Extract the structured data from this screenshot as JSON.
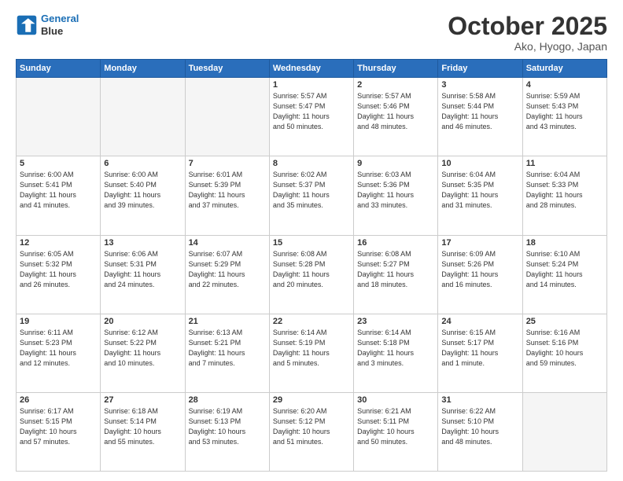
{
  "header": {
    "logo_line1": "General",
    "logo_line2": "Blue",
    "month": "October 2025",
    "location": "Ako, Hyogo, Japan"
  },
  "weekdays": [
    "Sunday",
    "Monday",
    "Tuesday",
    "Wednesday",
    "Thursday",
    "Friday",
    "Saturday"
  ],
  "weeks": [
    [
      {
        "day": "",
        "info": ""
      },
      {
        "day": "",
        "info": ""
      },
      {
        "day": "",
        "info": ""
      },
      {
        "day": "1",
        "info": "Sunrise: 5:57 AM\nSunset: 5:47 PM\nDaylight: 11 hours\nand 50 minutes."
      },
      {
        "day": "2",
        "info": "Sunrise: 5:57 AM\nSunset: 5:46 PM\nDaylight: 11 hours\nand 48 minutes."
      },
      {
        "day": "3",
        "info": "Sunrise: 5:58 AM\nSunset: 5:44 PM\nDaylight: 11 hours\nand 46 minutes."
      },
      {
        "day": "4",
        "info": "Sunrise: 5:59 AM\nSunset: 5:43 PM\nDaylight: 11 hours\nand 43 minutes."
      }
    ],
    [
      {
        "day": "5",
        "info": "Sunrise: 6:00 AM\nSunset: 5:41 PM\nDaylight: 11 hours\nand 41 minutes."
      },
      {
        "day": "6",
        "info": "Sunrise: 6:00 AM\nSunset: 5:40 PM\nDaylight: 11 hours\nand 39 minutes."
      },
      {
        "day": "7",
        "info": "Sunrise: 6:01 AM\nSunset: 5:39 PM\nDaylight: 11 hours\nand 37 minutes."
      },
      {
        "day": "8",
        "info": "Sunrise: 6:02 AM\nSunset: 5:37 PM\nDaylight: 11 hours\nand 35 minutes."
      },
      {
        "day": "9",
        "info": "Sunrise: 6:03 AM\nSunset: 5:36 PM\nDaylight: 11 hours\nand 33 minutes."
      },
      {
        "day": "10",
        "info": "Sunrise: 6:04 AM\nSunset: 5:35 PM\nDaylight: 11 hours\nand 31 minutes."
      },
      {
        "day": "11",
        "info": "Sunrise: 6:04 AM\nSunset: 5:33 PM\nDaylight: 11 hours\nand 28 minutes."
      }
    ],
    [
      {
        "day": "12",
        "info": "Sunrise: 6:05 AM\nSunset: 5:32 PM\nDaylight: 11 hours\nand 26 minutes."
      },
      {
        "day": "13",
        "info": "Sunrise: 6:06 AM\nSunset: 5:31 PM\nDaylight: 11 hours\nand 24 minutes."
      },
      {
        "day": "14",
        "info": "Sunrise: 6:07 AM\nSunset: 5:29 PM\nDaylight: 11 hours\nand 22 minutes."
      },
      {
        "day": "15",
        "info": "Sunrise: 6:08 AM\nSunset: 5:28 PM\nDaylight: 11 hours\nand 20 minutes."
      },
      {
        "day": "16",
        "info": "Sunrise: 6:08 AM\nSunset: 5:27 PM\nDaylight: 11 hours\nand 18 minutes."
      },
      {
        "day": "17",
        "info": "Sunrise: 6:09 AM\nSunset: 5:26 PM\nDaylight: 11 hours\nand 16 minutes."
      },
      {
        "day": "18",
        "info": "Sunrise: 6:10 AM\nSunset: 5:24 PM\nDaylight: 11 hours\nand 14 minutes."
      }
    ],
    [
      {
        "day": "19",
        "info": "Sunrise: 6:11 AM\nSunset: 5:23 PM\nDaylight: 11 hours\nand 12 minutes."
      },
      {
        "day": "20",
        "info": "Sunrise: 6:12 AM\nSunset: 5:22 PM\nDaylight: 11 hours\nand 10 minutes."
      },
      {
        "day": "21",
        "info": "Sunrise: 6:13 AM\nSunset: 5:21 PM\nDaylight: 11 hours\nand 7 minutes."
      },
      {
        "day": "22",
        "info": "Sunrise: 6:14 AM\nSunset: 5:19 PM\nDaylight: 11 hours\nand 5 minutes."
      },
      {
        "day": "23",
        "info": "Sunrise: 6:14 AM\nSunset: 5:18 PM\nDaylight: 11 hours\nand 3 minutes."
      },
      {
        "day": "24",
        "info": "Sunrise: 6:15 AM\nSunset: 5:17 PM\nDaylight: 11 hours\nand 1 minute."
      },
      {
        "day": "25",
        "info": "Sunrise: 6:16 AM\nSunset: 5:16 PM\nDaylight: 10 hours\nand 59 minutes."
      }
    ],
    [
      {
        "day": "26",
        "info": "Sunrise: 6:17 AM\nSunset: 5:15 PM\nDaylight: 10 hours\nand 57 minutes."
      },
      {
        "day": "27",
        "info": "Sunrise: 6:18 AM\nSunset: 5:14 PM\nDaylight: 10 hours\nand 55 minutes."
      },
      {
        "day": "28",
        "info": "Sunrise: 6:19 AM\nSunset: 5:13 PM\nDaylight: 10 hours\nand 53 minutes."
      },
      {
        "day": "29",
        "info": "Sunrise: 6:20 AM\nSunset: 5:12 PM\nDaylight: 10 hours\nand 51 minutes."
      },
      {
        "day": "30",
        "info": "Sunrise: 6:21 AM\nSunset: 5:11 PM\nDaylight: 10 hours\nand 50 minutes."
      },
      {
        "day": "31",
        "info": "Sunrise: 6:22 AM\nSunset: 5:10 PM\nDaylight: 10 hours\nand 48 minutes."
      },
      {
        "day": "",
        "info": ""
      }
    ]
  ]
}
